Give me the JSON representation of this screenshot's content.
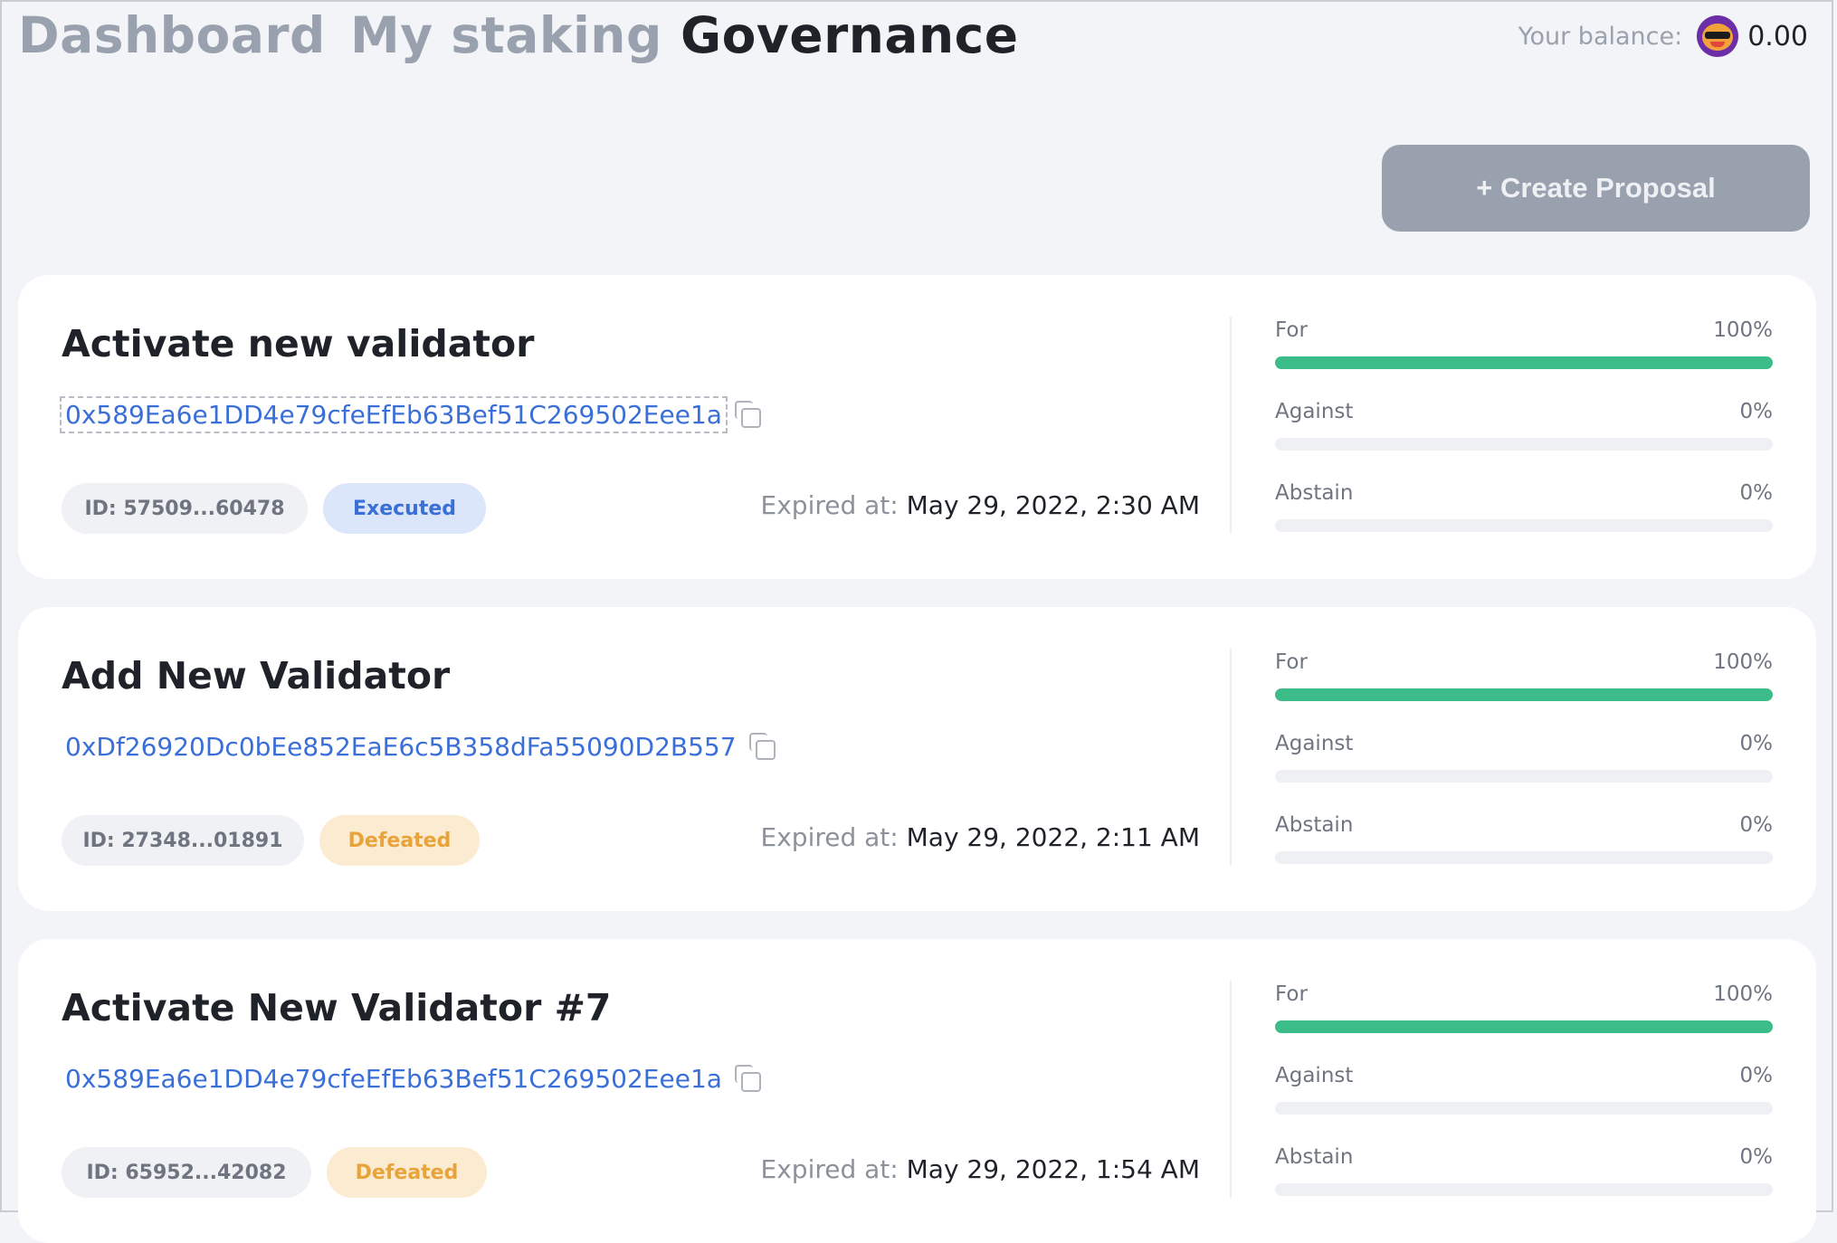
{
  "nav": {
    "tabs": [
      {
        "label": "Dashboard",
        "active": false
      },
      {
        "label": "My staking",
        "active": false
      },
      {
        "label": "Governance",
        "active": true
      }
    ]
  },
  "balance": {
    "label": "Your balance:",
    "value": "0.00",
    "icon": "ape-avatar-icon"
  },
  "create_button": {
    "label": "+ Create Proposal"
  },
  "colors": {
    "accent": "#3a6fd8",
    "for_bar": "#3cbc89",
    "executed_bg": "#dbe6fb",
    "defeated_bg": "#fbecd1",
    "defeated_text": "#e8a33a"
  },
  "proposals": [
    {
      "title": "Activate new validator",
      "address": "0x589Ea6e1DD4e79cfeEfEb63Bef51C269502Eee1a",
      "id": "ID: 57509...60478",
      "status": "Executed",
      "expired_label": "Expired at:",
      "expired_value": "May 29, 2022, 2:30 AM",
      "votes": [
        {
          "label": "For",
          "pct_text": "100%",
          "pct": 100
        },
        {
          "label": "Against",
          "pct_text": "0%",
          "pct": 0
        },
        {
          "label": "Abstain",
          "pct_text": "0%",
          "pct": 0
        }
      ]
    },
    {
      "title": "Add New Validator",
      "address": "0xDf26920Dc0bEe852EaE6c5B358dFa55090D2B557",
      "id": "ID: 27348...01891",
      "status": "Defeated",
      "expired_label": "Expired at:",
      "expired_value": "May 29, 2022, 2:11 AM",
      "votes": [
        {
          "label": "For",
          "pct_text": "100%",
          "pct": 100
        },
        {
          "label": "Against",
          "pct_text": "0%",
          "pct": 0
        },
        {
          "label": "Abstain",
          "pct_text": "0%",
          "pct": 0
        }
      ]
    },
    {
      "title": "Activate New Validator #7",
      "address": "0x589Ea6e1DD4e79cfeEfEb63Bef51C269502Eee1a",
      "id": "ID: 65952...42082",
      "status": "Defeated",
      "expired_label": "Expired at:",
      "expired_value": "May 29, 2022, 1:54 AM",
      "votes": [
        {
          "label": "For",
          "pct_text": "100%",
          "pct": 100
        },
        {
          "label": "Against",
          "pct_text": "0%",
          "pct": 0
        },
        {
          "label": "Abstain",
          "pct_text": "0%",
          "pct": 0
        }
      ]
    }
  ]
}
